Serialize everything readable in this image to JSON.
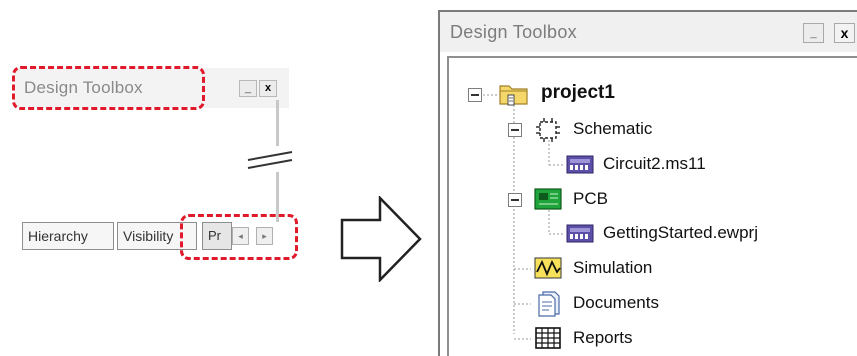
{
  "collapsed_view": {
    "title": "Design Toolbox",
    "minimize_glyph": "_",
    "close_glyph": "x",
    "tabs": [
      {
        "label": "Hierarchy"
      },
      {
        "label": "Visibility"
      },
      {
        "label": "Pr"
      }
    ],
    "scroll_left_glyph": "◂",
    "scroll_right_glyph": "▸"
  },
  "expanded_view": {
    "title": "Design Toolbox",
    "minimize_glyph": "_",
    "close_glyph": "x",
    "tree": {
      "root": {
        "label": "project1",
        "icon": "project-folder-icon"
      },
      "schematic": {
        "label": "Schematic",
        "icon": "schematic-chip-icon"
      },
      "schematic_file": {
        "label": "Circuit2.ms11",
        "icon": "circuit-file-icon"
      },
      "pcb": {
        "label": "PCB",
        "icon": "pcb-board-icon"
      },
      "pcb_file": {
        "label": "GettingStarted.ewprj",
        "icon": "circuit-file-icon"
      },
      "simulation": {
        "label": "Simulation",
        "icon": "waveform-icon"
      },
      "documents": {
        "label": "Documents",
        "icon": "document-icon"
      },
      "reports": {
        "label": "Reports",
        "icon": "report-grid-icon"
      }
    }
  },
  "colors": {
    "highlight_dash": "#e0192b",
    "title_text": "#7c7c7c",
    "tree_line": "#9a9a9a",
    "pcb_green": "#1fa33b",
    "file_purple": "#5b4fa8"
  }
}
